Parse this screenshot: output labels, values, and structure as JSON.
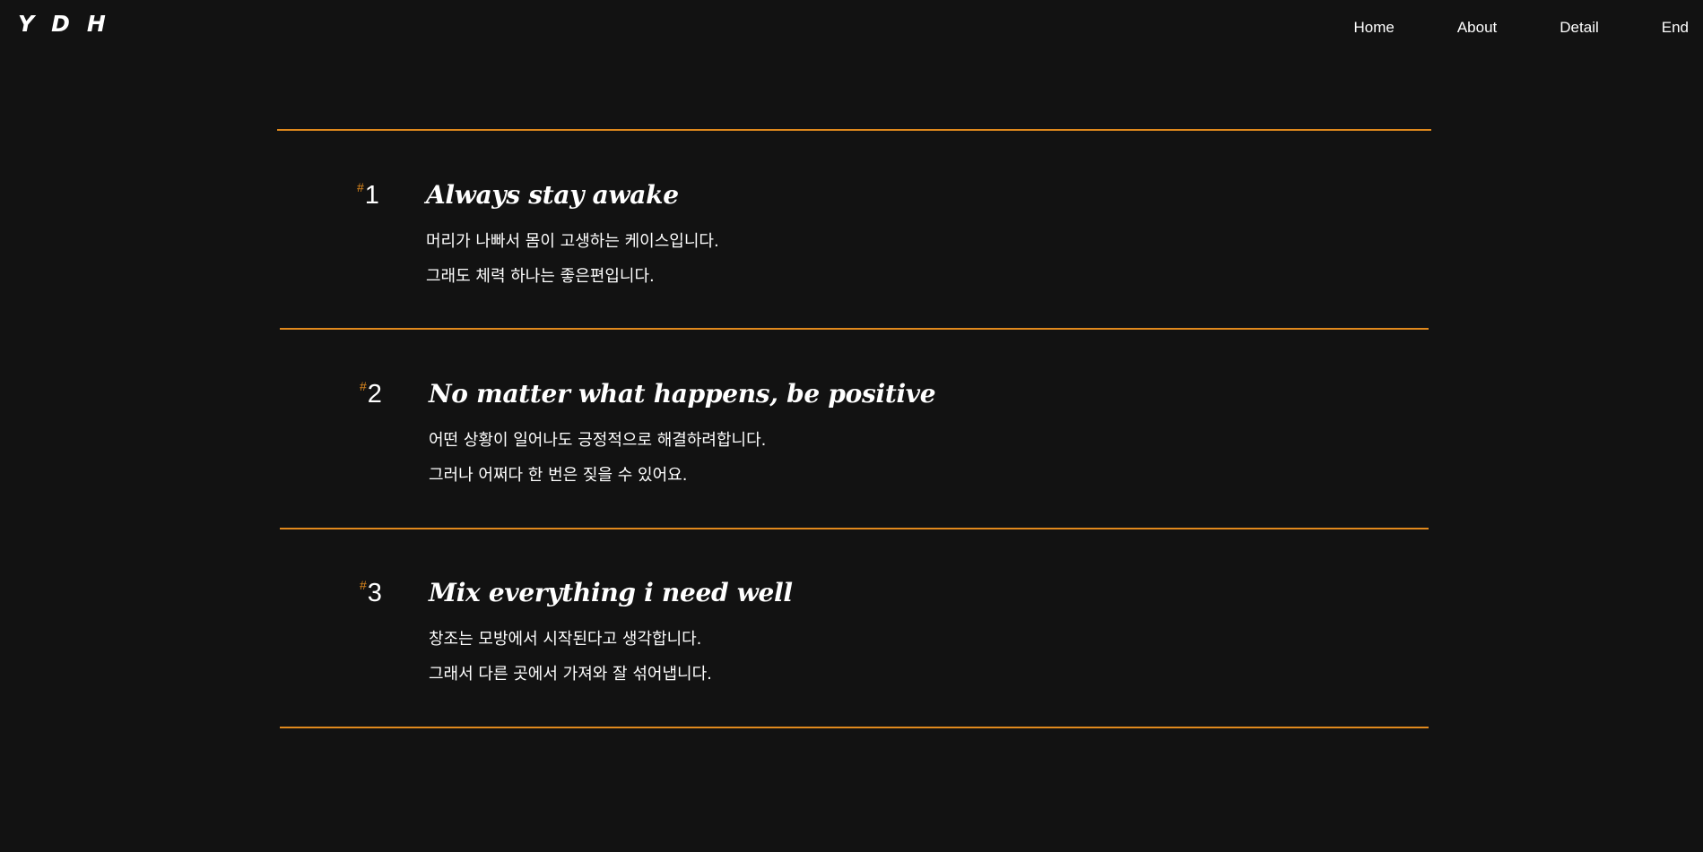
{
  "header": {
    "logo": [
      "Y",
      "D",
      "H"
    ],
    "nav": [
      "Home",
      "About",
      "Detail",
      "End"
    ]
  },
  "accent_color": "#e0891d",
  "background_color": "#121212",
  "items": [
    {
      "hash": "#",
      "number": "1",
      "title": "Always stay awake",
      "lines": [
        "머리가 나빠서 몸이 고생하는 케이스입니다.",
        "그래도 체력 하나는 좋은편입니다."
      ]
    },
    {
      "hash": "#",
      "number": "2",
      "title": "No matter what happens, be positive",
      "lines": [
        "어떤 상황이 일어나도 긍정적으로 해결하려합니다.",
        "그러나 어쩌다 한 번은 짖을 수 있어요."
      ]
    },
    {
      "hash": "#",
      "number": "3",
      "title": "Mix everything i need well",
      "lines": [
        "창조는 모방에서 시작된다고 생각합니다.",
        "그래서 다른 곳에서 가져와 잘 섞어냅니다."
      ]
    }
  ]
}
